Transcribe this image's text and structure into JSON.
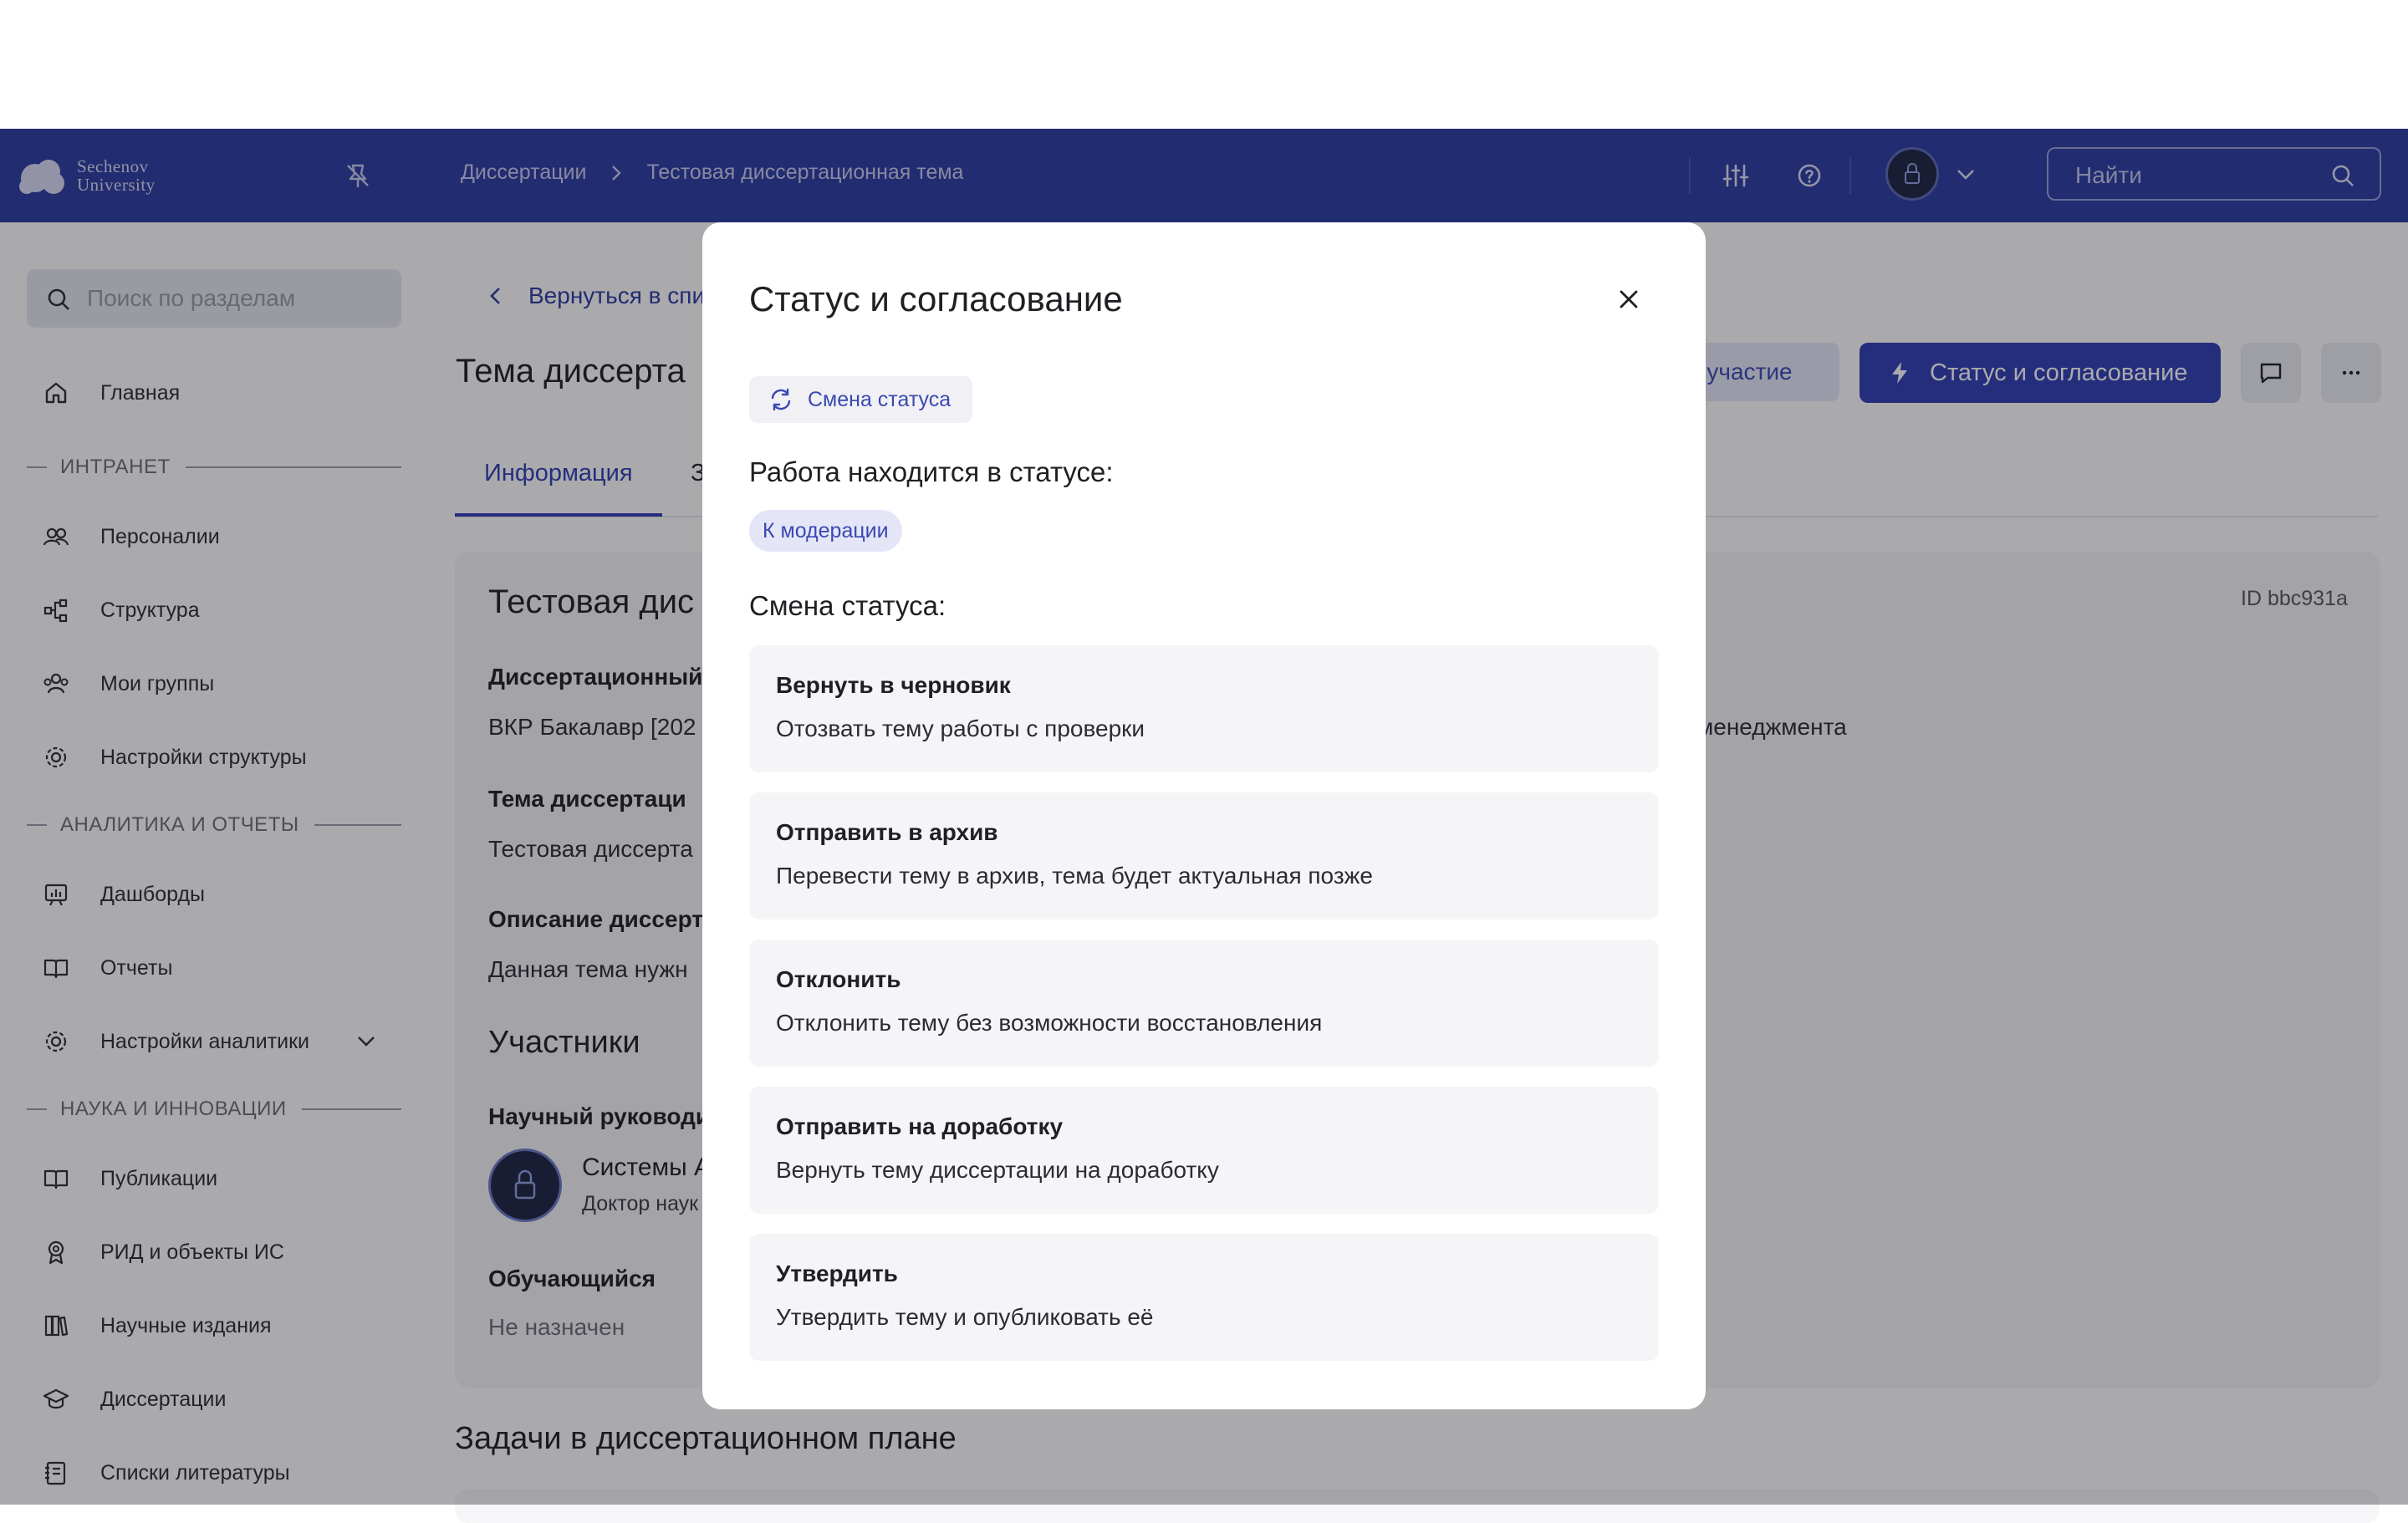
{
  "header": {
    "logo_line1": "Sechenov",
    "logo_line2": "University",
    "breadcrumbs": [
      "Диссертации",
      "Тестовая диссертационная тема"
    ],
    "search_placeholder": "Найти"
  },
  "sidebar": {
    "search_placeholder": "Поиск по разделам",
    "home": "Главная",
    "section_intranet": "ИНТРАНЕТ",
    "intranet_items": [
      "Персоналии",
      "Структура",
      "Мои группы",
      "Настройки структуры"
    ],
    "section_analytics": "АНАЛИТИКА И ОТЧЕТЫ",
    "analytics_items": [
      "Дашборды",
      "Отчеты",
      "Настройки аналитики"
    ],
    "section_science": "НАУКА И ИННОВАЦИИ",
    "science_items": [
      "Публикации",
      "РИД и объекты ИС",
      "Научные издания",
      "Диссертации",
      "Списки литературы"
    ]
  },
  "main": {
    "back_link": "Вернуться в спи",
    "page_title": "Тема диссерта",
    "participate_button": "а участие",
    "status_button": "Статус и согласование",
    "tab_info": "Информация",
    "tab_other": "З",
    "card_title": "Тестовая дис",
    "card_id": "ID bbc931a",
    "field1_label": "Диссертационный",
    "field1_value": "ВКР Бакалавр [202",
    "field1_value_right": "менеджмента",
    "field2_label": "Тема диссертаци",
    "field2_value": "Тестовая диссерта",
    "field3_label": "Описание диссерт",
    "field3_value": "Данная тема нужн",
    "participants_title": "Участники",
    "supervisor_label": "Научный руководи",
    "supervisor_name": "Системы А",
    "supervisor_degree": "Доктор наук",
    "student_label": "Обучающийся",
    "student_value": "Не назначен",
    "tasks_title": "Задачи в диссертационном плане"
  },
  "modal": {
    "title": "Статус и согласование",
    "change_status_chip": "Смена статуса",
    "current_label": "Работа находится в статусе:",
    "current_status": "К модерации",
    "change_label": "Смена статуса:",
    "options": [
      {
        "title": "Вернуть в черновик",
        "desc": "Отозвать тему работы с проверки"
      },
      {
        "title": "Отправить в архив",
        "desc": "Перевести тему в архив, тема будет актуальная позже"
      },
      {
        "title": "Отклонить",
        "desc": "Отклонить тему без возможности восстановления"
      },
      {
        "title": "Отправить на доработку",
        "desc": "Вернуть тему диссертации на доработку"
      },
      {
        "title": "Утвердить",
        "desc": "Утвердить тему и опубликовать её"
      }
    ]
  },
  "colors": {
    "brand": "#2b3aa0",
    "accent": "#2f3eb2",
    "pill_bg": "#e4e6f8"
  }
}
